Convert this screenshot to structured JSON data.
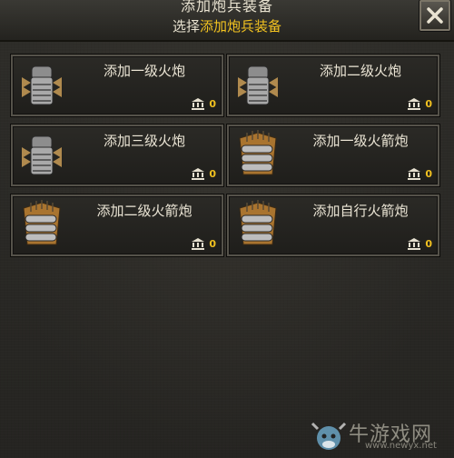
{
  "header": {
    "title": "添加炮兵装备",
    "subtitle_prefix": "选择",
    "subtitle_highlight": "添加炮兵装备"
  },
  "cards": [
    {
      "label": "添加一级火炮",
      "count": "0",
      "icon": "artillery-fist-icon"
    },
    {
      "label": "添加二级火炮",
      "count": "0",
      "icon": "artillery-fist-icon"
    },
    {
      "label": "添加三级火炮",
      "count": "0",
      "icon": "artillery-fist-icon"
    },
    {
      "label": "添加一级火箭炮",
      "count": "0",
      "icon": "rocket-artillery-icon"
    },
    {
      "label": "添加二级火箭炮",
      "count": "0",
      "icon": "rocket-artillery-icon"
    },
    {
      "label": "添加自行火箭炮",
      "count": "0",
      "icon": "rocket-artillery-icon"
    }
  ],
  "watermark": {
    "text": "牛游戏网",
    "url": "www.newyx.net"
  },
  "colors": {
    "highlight": "#f3c320",
    "count": "#f0c020",
    "text": "#ece6d6"
  }
}
